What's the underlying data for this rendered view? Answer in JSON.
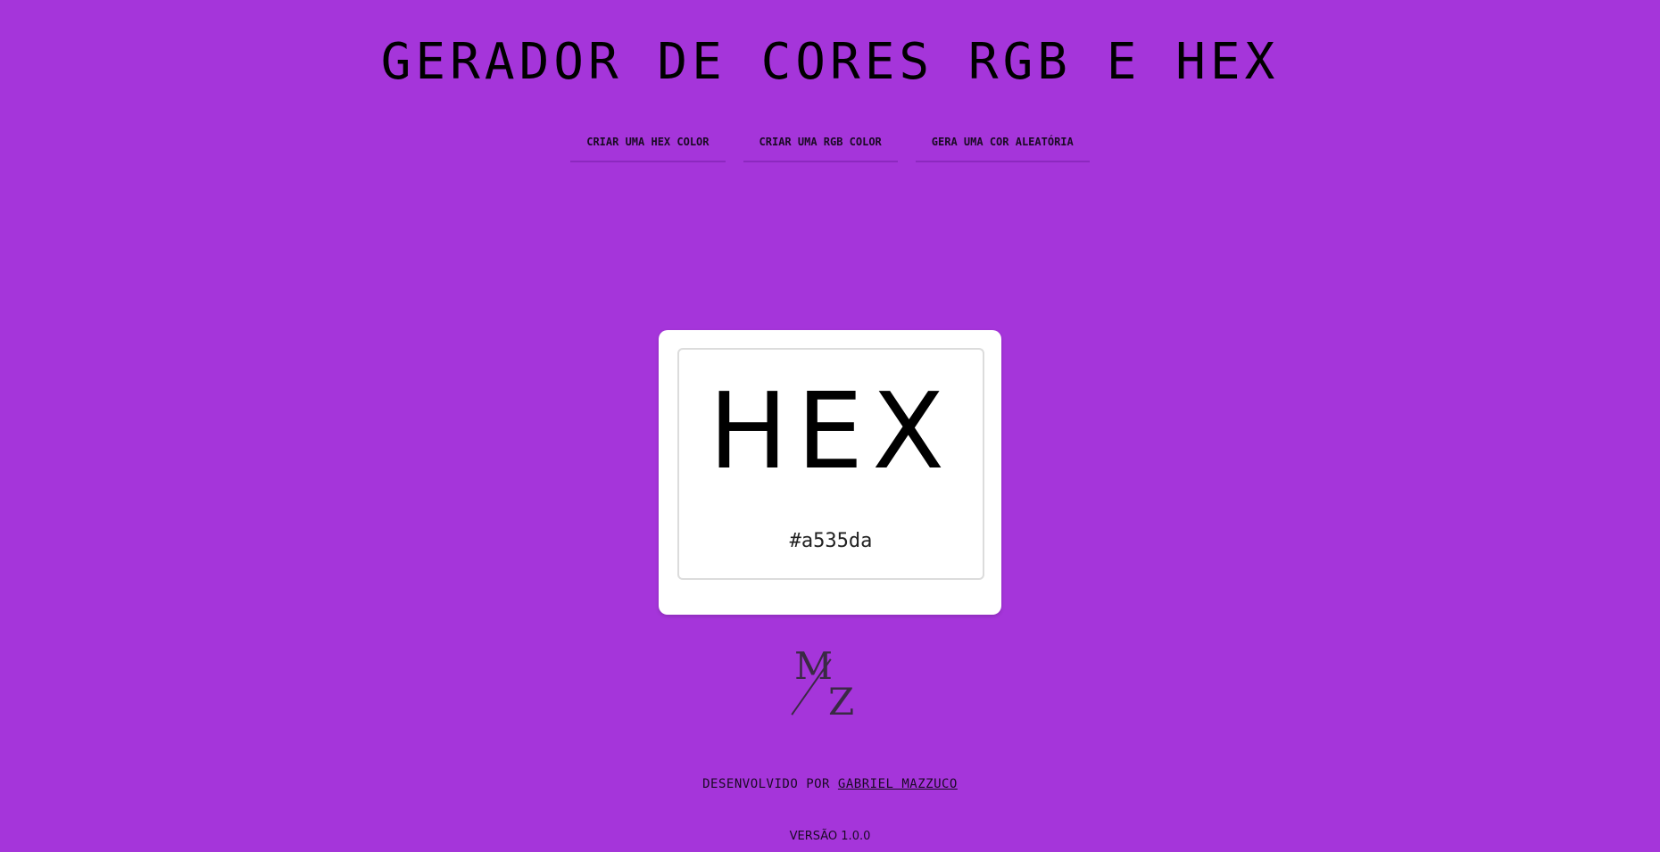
{
  "header": {
    "title": "GERADOR DE CORES RGB E HEX"
  },
  "nav": {
    "hex_button": "CRIAR UMA HEX COLOR",
    "rgb_button": "CRIAR UMA RGB COLOR",
    "random_button": "GERA UMA COR ALEATÓRIA"
  },
  "card": {
    "label": "HEX",
    "value": "#a535da"
  },
  "colors": {
    "background": "#a535da",
    "card_background": "#ffffff"
  },
  "logo": {
    "top": "M",
    "bottom": "Z",
    "icon": "mz-monogram-logo"
  },
  "footer": {
    "credit_prefix": "DESENVOLVIDO POR",
    "author": "GABRIEL MAZZUCO",
    "version": "VERSÃO 1.0.0"
  }
}
